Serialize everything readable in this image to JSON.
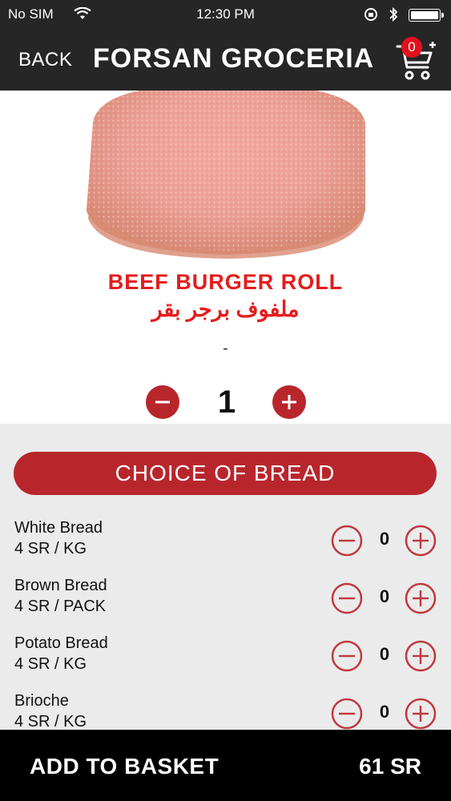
{
  "status_bar": {
    "carrier": "No SIM",
    "time": "12:30 PM"
  },
  "header": {
    "back_label": "BACK",
    "title": "FORSAN GROCERIA",
    "cart_count": "0"
  },
  "product": {
    "name": "BEEF BURGER ROLL",
    "name_arabic": "ملفوف برجر بقر",
    "description": "-",
    "quantity": "1"
  },
  "options": {
    "section_title": "CHOICE OF BREAD",
    "items": [
      {
        "name": "White Bread",
        "price": "4 SR / KG",
        "count": "0"
      },
      {
        "name": "Brown Bread",
        "price": "4 SR / PACK",
        "count": "0"
      },
      {
        "name": "Potato Bread",
        "price": "4 SR / KG",
        "count": "0"
      },
      {
        "name": "Brioche",
        "price": "4 SR / KG",
        "count": "0"
      }
    ]
  },
  "footer": {
    "add_label": "ADD TO BASKET",
    "total": "61 SR"
  },
  "colors": {
    "header_bg": "#262626",
    "accent": "#b8262c",
    "product_title": "#e51c1c",
    "badge": "#e3101d",
    "options_bg": "#ebebeb",
    "footer_bg": "#000000"
  }
}
